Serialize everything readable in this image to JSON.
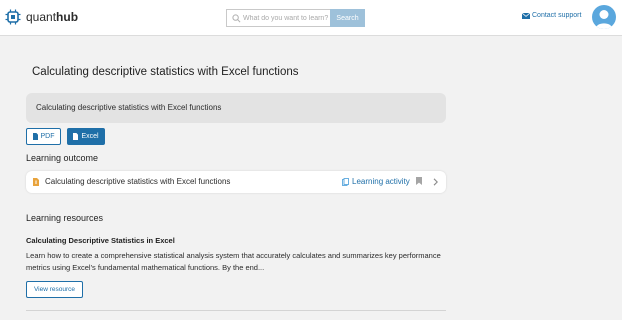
{
  "header": {
    "brand_prefix": "quant",
    "brand_suffix": "hub",
    "search_placeholder": "What do you want to learn?",
    "search_button": "Search",
    "contact_label": "Contact support"
  },
  "page": {
    "title": "Calculating descriptive statistics with Excel functions",
    "banner_text": "Calculating descriptive statistics with Excel functions",
    "pdf_label": "PDF",
    "excel_label": "Excel"
  },
  "outcome": {
    "heading": "Learning outcome",
    "item_text": "Calculating descriptive statistics with Excel functions",
    "activity_label": "Learning activity"
  },
  "resources": {
    "heading": "Learning resources",
    "item_title": "Calculating Descriptive Statistics in Excel",
    "item_description": "Learn how to create a comprehensive statistical analysis system that accurately calculates and summarizes key performance metrics using Excel's fundamental mathematical functions. By the end...",
    "view_label": "View resource"
  },
  "colors": {
    "accent": "#1f6fa8",
    "search_button": "#9ec1da",
    "avatar": "#5aa7dd",
    "outcome_icon": "#e8a33c",
    "page_background": "#f2f2f2"
  },
  "icons": [
    "quanthub-logo-icon",
    "search-icon",
    "mail-icon",
    "avatar-icon",
    "pdf-icon",
    "excel-icon",
    "outcome-icon",
    "copy-icon",
    "bookmark-icon",
    "chevron-right-icon"
  ]
}
